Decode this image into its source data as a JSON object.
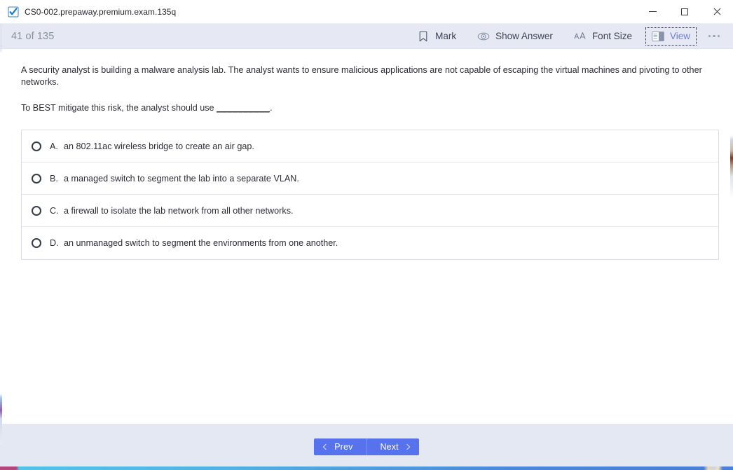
{
  "window": {
    "title": "CS0-002.prepaway.premium.exam.135q",
    "app_icon": "blue-check-icon",
    "controls": {
      "minimize": "minimize-icon",
      "maximize": "maximize-icon",
      "close": "close-icon"
    }
  },
  "toolbar": {
    "progress": "41 of 135",
    "current_question": 41,
    "total_questions": 135,
    "actions": [
      {
        "label": "Mark",
        "icon": "bookmark-icon",
        "focused": false
      },
      {
        "label": "Show Answer",
        "icon": "eye-icon",
        "focused": false
      },
      {
        "label": "Font Size",
        "icon": "font-size-icon",
        "focused": false
      },
      {
        "label": "View",
        "icon": "layout-panel-icon",
        "focused": true
      }
    ],
    "more_label": "More options",
    "background": "#e6e9f4",
    "focus_color": "#6f7fd6"
  },
  "question": {
    "body": "A security analyst is building a malware analysis lab. The analyst wants to ensure malicious applications are not capable of escaping the virtual machines and pivoting to other networks.",
    "stem_before": "To BEST mitigate this risk, the analyst should use ",
    "stem_blank": "__________",
    "stem_after": ".",
    "options": [
      {
        "letter": "A.",
        "text": "an 802.11ac wireless bridge to create an air gap.",
        "selected": false
      },
      {
        "letter": "B.",
        "text": "a managed switch to segment the lab into a separate VLAN.",
        "selected": false
      },
      {
        "letter": "C.",
        "text": "a firewall to isolate the lab network from all other networks.",
        "selected": false
      },
      {
        "letter": "D.",
        "text": "an unmanaged switch to segment the environments from one another.",
        "selected": false
      }
    ]
  },
  "footer": {
    "prev_label": "Prev",
    "next_label": "Next",
    "button_color": "#5672ed",
    "background": "#e4e8f3"
  }
}
